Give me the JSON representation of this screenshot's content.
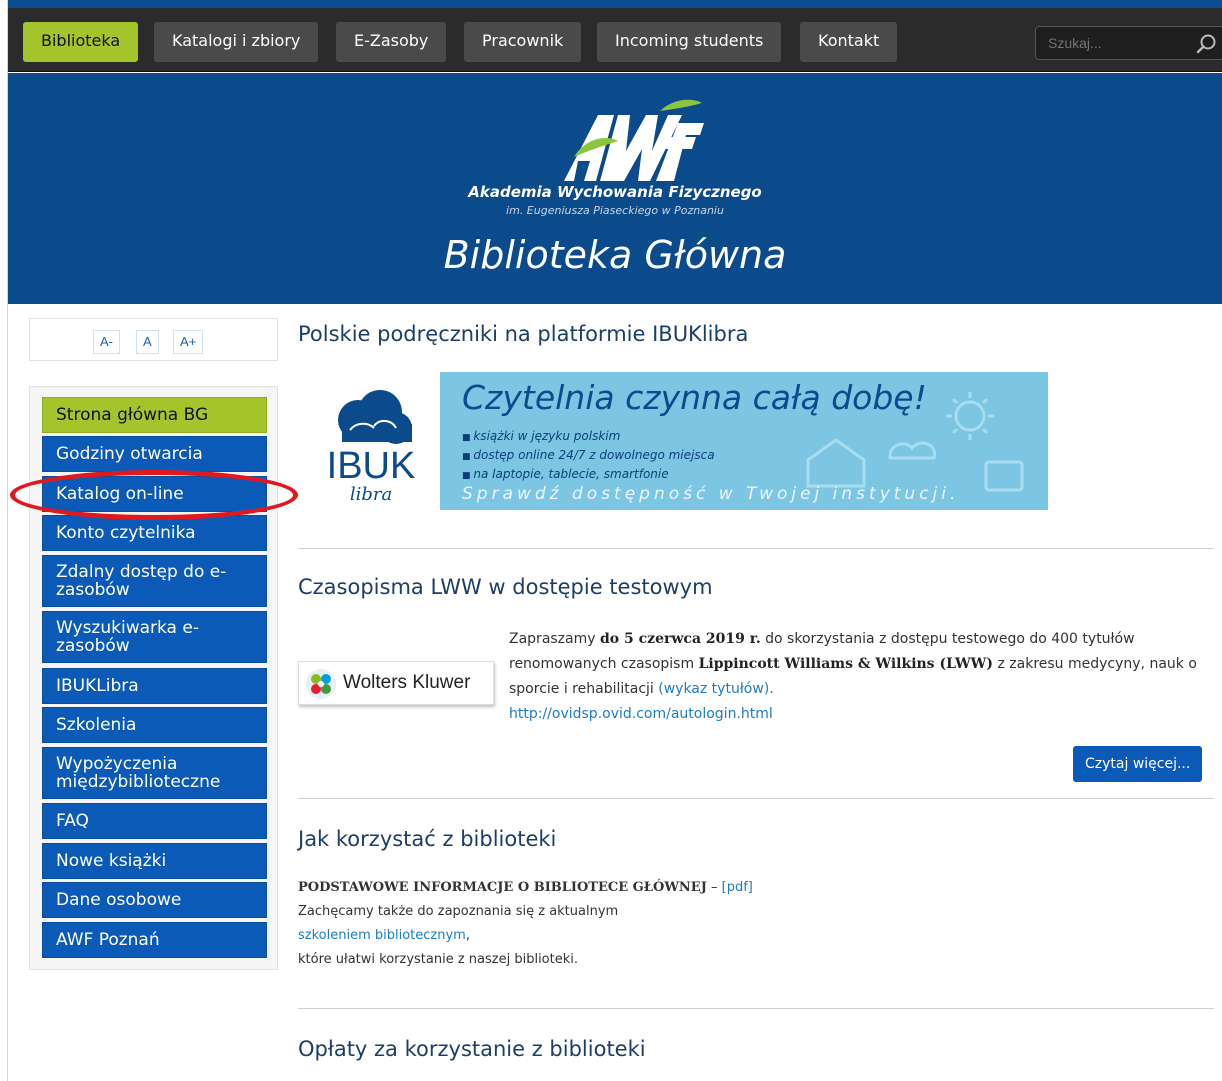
{
  "nav": {
    "items": [
      "Biblioteka",
      "Katalogi i zbiory",
      "E-Zasoby",
      "Pracownik",
      "Incoming students",
      "Kontakt"
    ],
    "search_placeholder": "Szukaj..."
  },
  "header": {
    "institution": "Akademia Wychowania Fizycznego",
    "institution_sub": "im. Eugeniusza Piaseckiego w Poznaniu",
    "title": "Biblioteka Główna"
  },
  "font_controls": [
    "A-",
    "A",
    "A+"
  ],
  "sidebar": {
    "items": [
      "Strona główna BG",
      "Godziny otwarcia",
      "Katalog on-line",
      "Konto czytelnika",
      "Zdalny dostęp do e-zasobów",
      "Wyszukiwarka e-zasobów",
      "IBUKLibra",
      "Szkolenia",
      "Wypożyczenia międzybiblioteczne",
      "FAQ",
      "Nowe książki",
      "Dane osobowe",
      "AWF Poznań"
    ]
  },
  "sections": {
    "ibuk": {
      "title": "Polskie podręczniki na platformie IBUKlibra",
      "logo_text": "IBUK",
      "logo_sub": "libra",
      "banner_title": "Czytelnia czynna całą dobę!",
      "banner_bullets": [
        "książki w języku polskim",
        "dostęp online 24/7 z dowolnego miejsca",
        "na laptopie, tablecie, smartfonie"
      ],
      "banner_cta": "Sprawdź dostępność w Twojej instytucji."
    },
    "lww": {
      "title": "Czasopisma LWW w dostępie testowym",
      "logo_text": "Wolters Kluwer",
      "text_1": "Zapraszamy ",
      "text_bold_1": "do 5 czerwca 2019 r.",
      "text_2": " do skorzystania z dostępu testowego do 400 tytułów renomowanych czasopism ",
      "text_bold_2": "Lippincott Williams & Wilkins (LWW)",
      "text_3": " z zakresu medycyny, nauk o sporcie i rehabilitacji ",
      "link_list": "(wykaz tytułów).",
      "link_url": "http://ovidsp.ovid.com/autologin.html",
      "read_more": "Czytaj więcej..."
    },
    "howto": {
      "title": "Jak korzystać z biblioteki",
      "bold_text": "PODSTAWOWE INFORMACJE O BIBLIOTECE GŁÓWNEJ",
      "dash": " – ",
      "pdf_link": "[pdf]",
      "line_2": "Zachęcamy także do zapoznania się z aktualnym",
      "training_link": "szkoleniem bibliotecznym",
      "comma": ",",
      "line_4": "które ułatwi korzystanie z naszej biblioteki."
    },
    "fees": {
      "title": "Opłaty za korzystanie z biblioteki"
    }
  },
  "colors": {
    "nav_bg": "#2b2b2b",
    "nav_active": "#a3c42a",
    "header_bg": "#0b4a8b",
    "sidebar_item": "#0b5ab8",
    "banner_bg": "#7cc6e4",
    "highlight": "#e0191f"
  }
}
